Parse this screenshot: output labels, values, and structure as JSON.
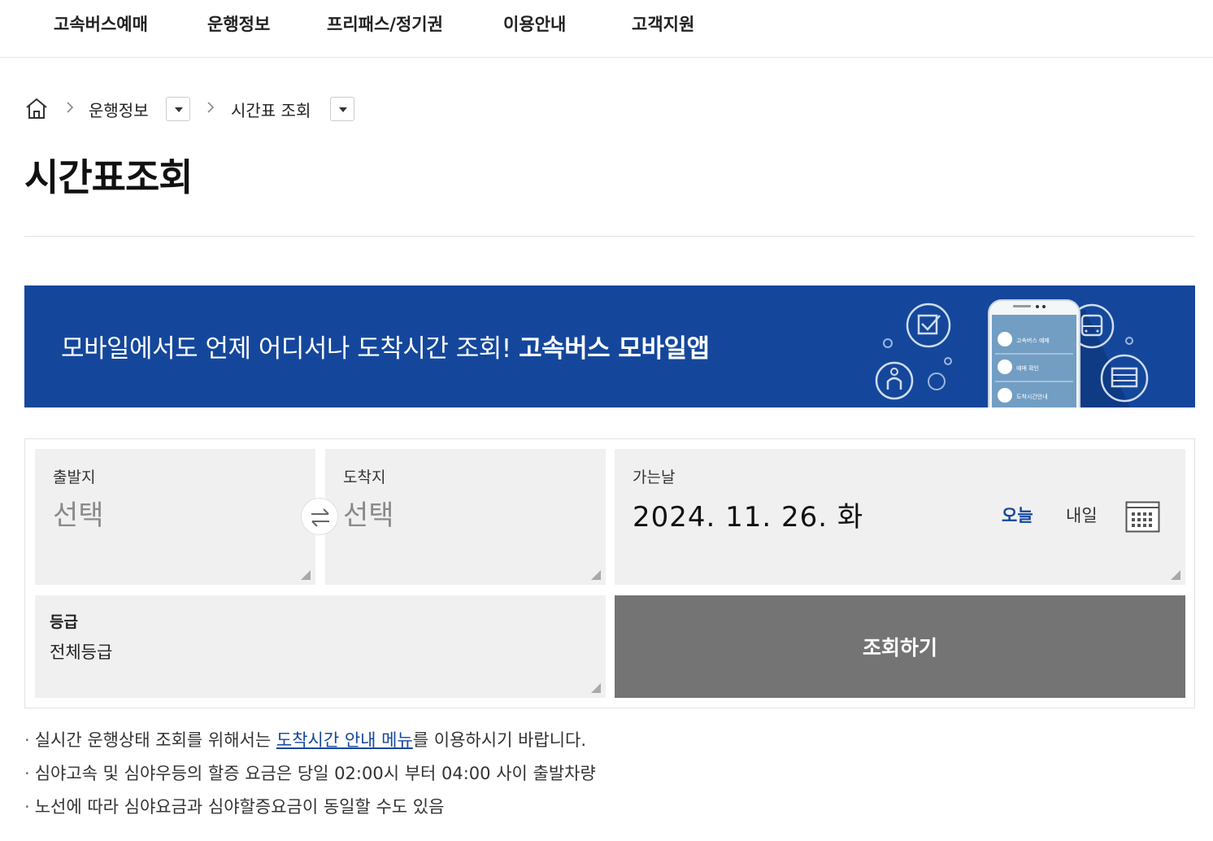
{
  "nav": {
    "items": [
      "고속버스예매",
      "운행정보",
      "프리패스/정기권",
      "이용안내",
      "고객지원"
    ]
  },
  "breadcrumb": {
    "level1": "운행정보",
    "level2": "시간표 조회"
  },
  "page": {
    "title": "시간표조회"
  },
  "banner": {
    "text": "모바일에서도 언제 어디서나 도착시간 조회! ",
    "highlight": "고속버스 모바일앱",
    "phone_menu": [
      "고속버스 예매",
      "예매 확인",
      "도착시간안내"
    ]
  },
  "search": {
    "departure_label": "출발지",
    "departure_placeholder": "선택",
    "arrival_label": "도착지",
    "arrival_placeholder": "선택",
    "date_label": "가는날",
    "date_value": "2024. 11. 26. 화",
    "today_label": "오늘",
    "tomorrow_label": "내일",
    "grade_label": "등급",
    "grade_value": "전체등급",
    "submit_label": "조회하기"
  },
  "notes": {
    "note1_pre": "실시간 운행상태 조회를 위해서는 ",
    "note1_link": "도착시간 안내 메뉴",
    "note1_post": "를 이용하시기 바랍니다.",
    "note2": "심야고속 및 심야우등의 할증 요금은 당일 02:00시 부터 04:00 사이 출발차량",
    "note3": "노선에 따라 심야요금과 심야할증요금이 동일할 수도 있음",
    "bullet": "·"
  },
  "colors": {
    "brand_blue": "#14479b",
    "field_bg": "#f0f0f0",
    "submit_bg": "#747474"
  }
}
